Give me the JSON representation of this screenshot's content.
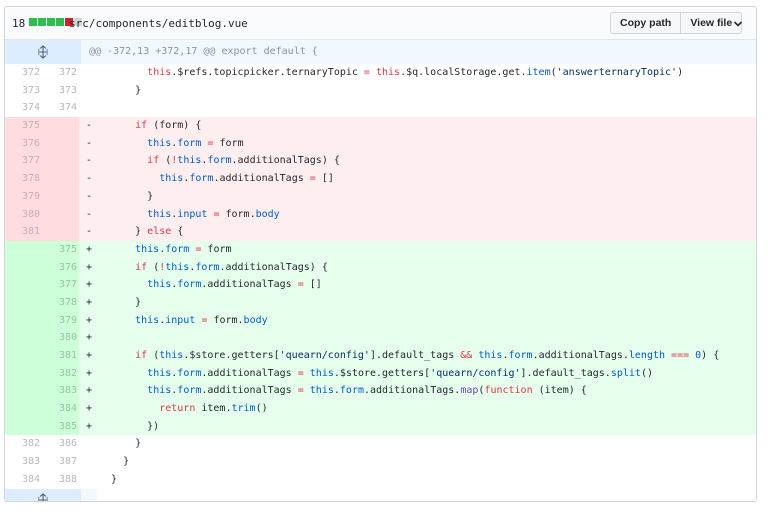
{
  "file": {
    "changes_count": "18",
    "diffstat_colors": [
      "#2cbe4e",
      "#2cbe4e",
      "#2cbe4e",
      "#2cbe4e",
      "#cb2431",
      "#d1d5da"
    ],
    "filename": "src/components/editblog.vue",
    "copy_path_label": "Copy path",
    "view_file_label": "View file"
  },
  "hunk_header": "@@ -372,13 +372,17 @@ export default {",
  "lines": [
    {
      "type": "ctx",
      "old": "372",
      "new": "372",
      "mark": "",
      "tokens": [
        [
          "",
          "        "
        ],
        [
          "kw",
          "this"
        ],
        [
          "",
          ".$refs.topicpicker.ternaryTopic "
        ],
        [
          "kw",
          "="
        ],
        [
          "",
          " "
        ],
        [
          "kw",
          "this"
        ],
        [
          "",
          ".$q.localStorage.get."
        ],
        [
          "pr",
          "item"
        ],
        [
          "",
          "("
        ],
        [
          "st",
          "'answerternaryTopic'"
        ],
        [
          "",
          ")"
        ]
      ]
    },
    {
      "type": "ctx",
      "old": "373",
      "new": "373",
      "mark": "",
      "tokens": [
        [
          "",
          "      }"
        ]
      ]
    },
    {
      "type": "ctx",
      "old": "374",
      "new": "374",
      "mark": "",
      "tokens": [
        [
          "",
          ""
        ]
      ]
    },
    {
      "type": "del",
      "old": "375",
      "new": "",
      "mark": "-",
      "tokens": [
        [
          "",
          "      "
        ],
        [
          "kw",
          "if"
        ],
        [
          "",
          " (form) {"
        ]
      ]
    },
    {
      "type": "del",
      "old": "376",
      "new": "",
      "mark": "-",
      "tokens": [
        [
          "",
          "        "
        ],
        [
          "pr",
          "this"
        ],
        [
          "",
          "."
        ],
        [
          "pr",
          "form"
        ],
        [
          "",
          " "
        ],
        [
          "kw",
          "="
        ],
        [
          "",
          " form"
        ]
      ]
    },
    {
      "type": "del",
      "old": "377",
      "new": "",
      "mark": "-",
      "tokens": [
        [
          "",
          "        "
        ],
        [
          "kw",
          "if"
        ],
        [
          "",
          " ("
        ],
        [
          "kw",
          "!"
        ],
        [
          "pr",
          "this"
        ],
        [
          "",
          "."
        ],
        [
          "pr",
          "form"
        ],
        [
          "",
          ".additionalTags) {"
        ]
      ]
    },
    {
      "type": "del",
      "old": "378",
      "new": "",
      "mark": "-",
      "tokens": [
        [
          "",
          "          "
        ],
        [
          "pr",
          "this"
        ],
        [
          "",
          "."
        ],
        [
          "pr",
          "form"
        ],
        [
          "",
          ".additionalTags "
        ],
        [
          "kw",
          "="
        ],
        [
          "",
          " []"
        ]
      ]
    },
    {
      "type": "del",
      "old": "379",
      "new": "",
      "mark": "-",
      "tokens": [
        [
          "",
          "        }"
        ]
      ]
    },
    {
      "type": "del",
      "old": "380",
      "new": "",
      "mark": "-",
      "tokens": [
        [
          "",
          "        "
        ],
        [
          "pr",
          "this"
        ],
        [
          "",
          "."
        ],
        [
          "pr",
          "input"
        ],
        [
          "",
          " "
        ],
        [
          "kw",
          "="
        ],
        [
          "",
          " form."
        ],
        [
          "pr",
          "body"
        ]
      ]
    },
    {
      "type": "del",
      "old": "381",
      "new": "",
      "mark": "-",
      "tokens": [
        [
          "",
          "      } "
        ],
        [
          "kw",
          "else"
        ],
        [
          "",
          " {"
        ]
      ]
    },
    {
      "type": "add",
      "old": "",
      "new": "375",
      "mark": "+",
      "tokens": [
        [
          "",
          "      "
        ],
        [
          "pr",
          "this"
        ],
        [
          "",
          "."
        ],
        [
          "pr",
          "form"
        ],
        [
          "",
          " "
        ],
        [
          "kw",
          "="
        ],
        [
          "",
          " form"
        ]
      ]
    },
    {
      "type": "add",
      "old": "",
      "new": "376",
      "mark": "+",
      "tokens": [
        [
          "",
          "      "
        ],
        [
          "kw",
          "if"
        ],
        [
          "",
          " ("
        ],
        [
          "kw",
          "!"
        ],
        [
          "pr",
          "this"
        ],
        [
          "",
          "."
        ],
        [
          "pr",
          "form"
        ],
        [
          "",
          ".additionalTags) {"
        ]
      ]
    },
    {
      "type": "add",
      "old": "",
      "new": "377",
      "mark": "+",
      "tokens": [
        [
          "",
          "        "
        ],
        [
          "pr",
          "this"
        ],
        [
          "",
          "."
        ],
        [
          "pr",
          "form"
        ],
        [
          "",
          ".additionalTags "
        ],
        [
          "kw",
          "="
        ],
        [
          "",
          " []"
        ]
      ]
    },
    {
      "type": "add",
      "old": "",
      "new": "378",
      "mark": "+",
      "tokens": [
        [
          "",
          "      }"
        ]
      ]
    },
    {
      "type": "add",
      "old": "",
      "new": "379",
      "mark": "+",
      "tokens": [
        [
          "",
          "      "
        ],
        [
          "pr",
          "this"
        ],
        [
          "",
          "."
        ],
        [
          "pr",
          "input"
        ],
        [
          "",
          " "
        ],
        [
          "kw",
          "="
        ],
        [
          "",
          " form."
        ],
        [
          "pr",
          "body"
        ]
      ]
    },
    {
      "type": "add",
      "old": "",
      "new": "380",
      "mark": "+",
      "tokens": [
        [
          "",
          ""
        ]
      ]
    },
    {
      "type": "add",
      "old": "",
      "new": "381",
      "mark": "+",
      "tokens": [
        [
          "",
          "      "
        ],
        [
          "kw",
          "if"
        ],
        [
          "",
          " ("
        ],
        [
          "pr",
          "this"
        ],
        [
          "",
          ".$store.getters["
        ],
        [
          "st",
          "'quearn/config'"
        ],
        [
          "",
          "].default_tags "
        ],
        [
          "kw",
          "&&"
        ],
        [
          "",
          " "
        ],
        [
          "pr",
          "this"
        ],
        [
          "",
          "."
        ],
        [
          "pr",
          "form"
        ],
        [
          "",
          ".additionalTags."
        ],
        [
          "pr",
          "length"
        ],
        [
          "",
          " "
        ],
        [
          "kw",
          "==="
        ],
        [
          "",
          " "
        ],
        [
          "pr",
          "0"
        ],
        [
          "",
          ") {"
        ]
      ]
    },
    {
      "type": "add",
      "old": "",
      "new": "382",
      "mark": "+",
      "tokens": [
        [
          "",
          "        "
        ],
        [
          "pr",
          "this"
        ],
        [
          "",
          "."
        ],
        [
          "pr",
          "form"
        ],
        [
          "",
          ".additionalTags "
        ],
        [
          "kw",
          "="
        ],
        [
          "",
          " "
        ],
        [
          "pr",
          "this"
        ],
        [
          "",
          ".$store.getters["
        ],
        [
          "st",
          "'quearn/config'"
        ],
        [
          "",
          "].default_tags."
        ],
        [
          "pr",
          "split"
        ],
        [
          "",
          "()"
        ]
      ]
    },
    {
      "type": "add",
      "old": "",
      "new": "383",
      "mark": "+",
      "tokens": [
        [
          "",
          "        "
        ],
        [
          "pr",
          "this"
        ],
        [
          "",
          "."
        ],
        [
          "pr",
          "form"
        ],
        [
          "",
          ".additionalTags "
        ],
        [
          "kw",
          "="
        ],
        [
          "",
          " "
        ],
        [
          "pr",
          "this"
        ],
        [
          "",
          "."
        ],
        [
          "pr",
          "form"
        ],
        [
          "",
          ".additionalTags."
        ],
        [
          "fn",
          "map"
        ],
        [
          "",
          "("
        ],
        [
          "kw",
          "function"
        ],
        [
          "",
          " (item) {"
        ]
      ]
    },
    {
      "type": "add",
      "old": "",
      "new": "384",
      "mark": "+",
      "tokens": [
        [
          "",
          "          "
        ],
        [
          "kw",
          "return"
        ],
        [
          "",
          " item."
        ],
        [
          "pr",
          "trim"
        ],
        [
          "",
          "()"
        ]
      ]
    },
    {
      "type": "add",
      "old": "",
      "new": "385",
      "mark": "+",
      "tokens": [
        [
          "",
          "        })"
        ]
      ]
    },
    {
      "type": "ctx",
      "old": "382",
      "new": "386",
      "mark": "",
      "tokens": [
        [
          "",
          "      }"
        ]
      ]
    },
    {
      "type": "ctx",
      "old": "383",
      "new": "387",
      "mark": "",
      "tokens": [
        [
          "",
          "    }"
        ]
      ]
    },
    {
      "type": "ctx",
      "old": "384",
      "new": "388",
      "mark": "",
      "tokens": [
        [
          "",
          "  }"
        ]
      ]
    }
  ]
}
